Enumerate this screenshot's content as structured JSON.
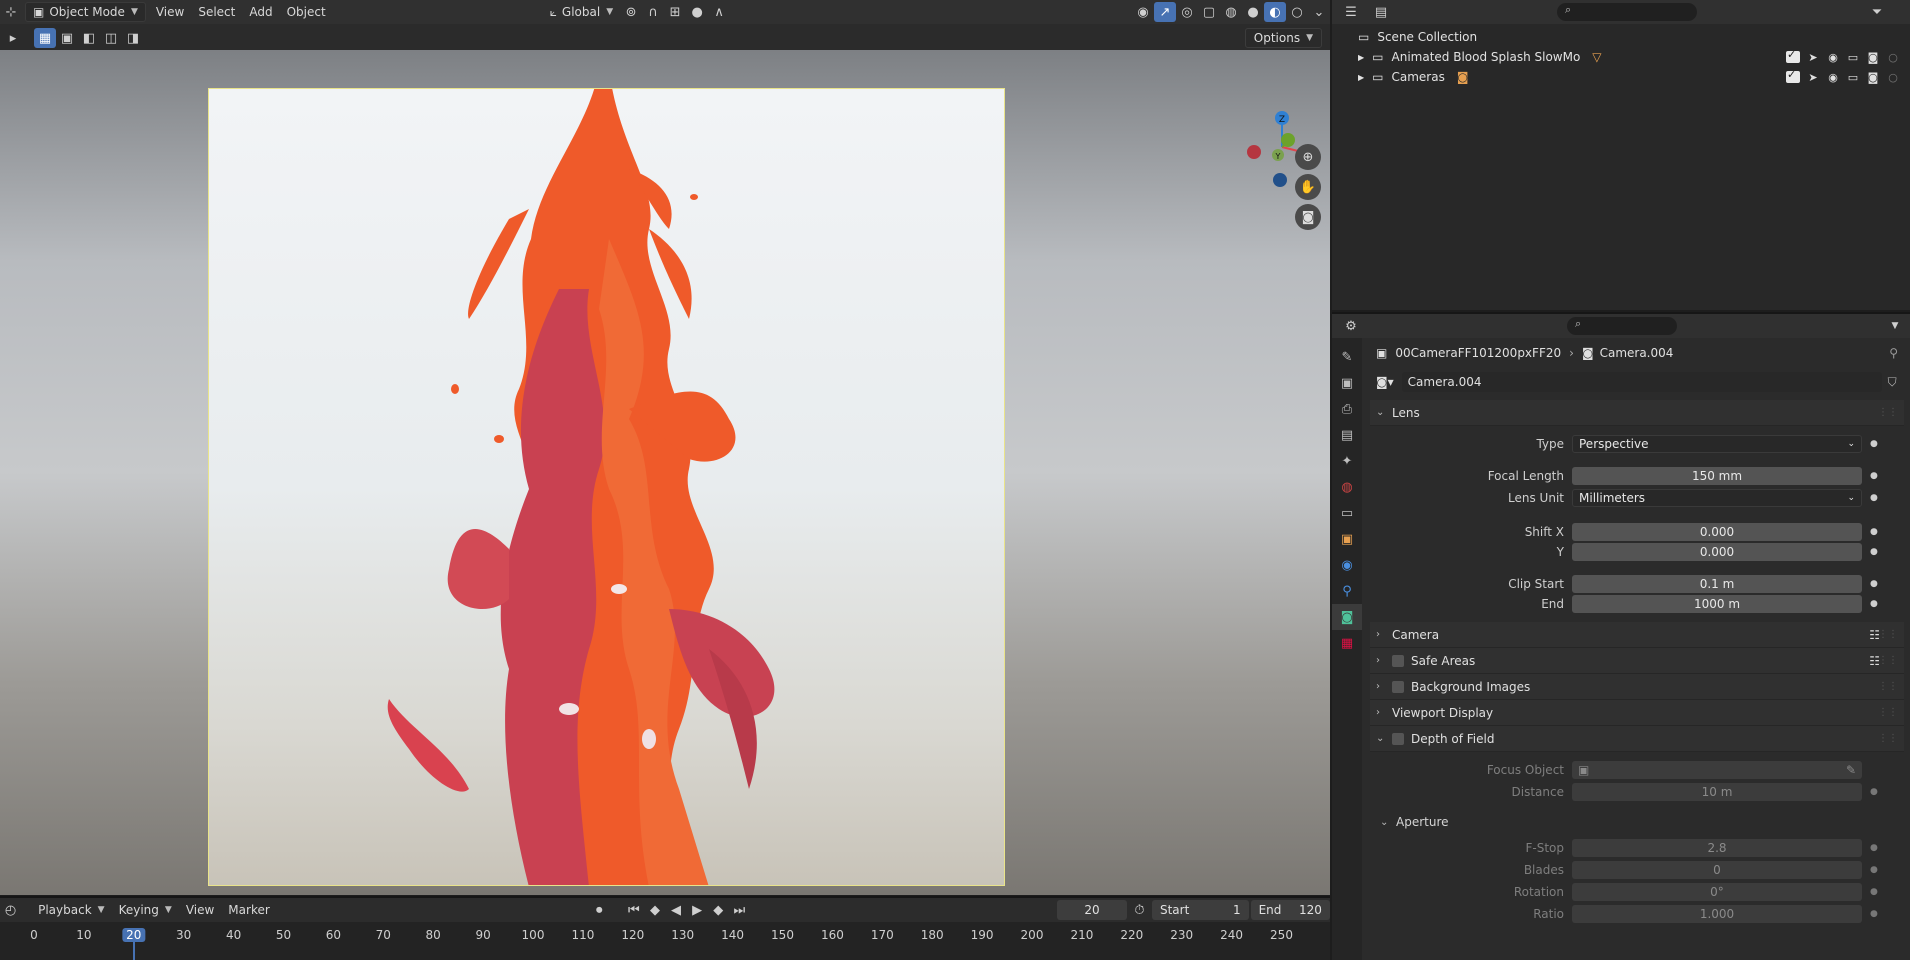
{
  "viewport": {
    "mode_label": "Object Mode",
    "menus": [
      "View",
      "Select",
      "Add",
      "Object"
    ],
    "transform_orientation": "Global",
    "options_label": "Options",
    "gizmo_axes": {
      "z": "Z",
      "y": "Y",
      "x": "X"
    },
    "colors": {
      "axis_x": "#e1444d",
      "axis_y": "#6ca22b",
      "axis_z": "#2f80d3",
      "frame": "#e9e48a",
      "splash_main": "#ef5a2a",
      "splash_dark": "#c23b45"
    }
  },
  "timeline": {
    "menus": [
      "Playback",
      "Keying",
      "View",
      "Marker"
    ],
    "current_frame": "20",
    "start_label": "Start",
    "start_value": "1",
    "end_label": "End",
    "end_value": "120",
    "ticks": [
      "0",
      "10",
      "20",
      "30",
      "40",
      "50",
      "60",
      "70",
      "80",
      "90",
      "100",
      "110",
      "120",
      "130",
      "140",
      "150",
      "160",
      "170",
      "180",
      "190",
      "200",
      "210",
      "220",
      "230",
      "240",
      "250"
    ],
    "active_tick": "20"
  },
  "outliner": {
    "root_label": "Scene Collection",
    "items": [
      {
        "label": "Animated Blood Splash SlowMo"
      },
      {
        "label": "Cameras"
      }
    ]
  },
  "properties": {
    "object_name": "00CameraFF101200pxFF20",
    "data_name": "Camera.004",
    "datablock_value": "Camera.004",
    "lens": {
      "title": "Lens",
      "type_label": "Type",
      "type_value": "Perspective",
      "focal_label": "Focal Length",
      "focal_value": "150 mm",
      "unit_label": "Lens Unit",
      "unit_value": "Millimeters",
      "shiftx_label": "Shift X",
      "shiftx_value": "0.000",
      "shifty_label": "Y",
      "shifty_value": "0.000",
      "clipstart_label": "Clip Start",
      "clipstart_value": "0.1 m",
      "clipend_label": "End",
      "clipend_value": "1000 m"
    },
    "panels": {
      "camera": "Camera",
      "safe_areas": "Safe Areas",
      "background_images": "Background Images",
      "viewport_display": "Viewport Display",
      "dof": "Depth of Field"
    },
    "dof": {
      "focus_object_label": "Focus Object",
      "distance_label": "Distance",
      "distance_value": "10 m",
      "aperture_title": "Aperture",
      "fstop_label": "F-Stop",
      "fstop_value": "2.8",
      "blades_label": "Blades",
      "blades_value": "0",
      "rotation_label": "Rotation",
      "rotation_value": "0°",
      "ratio_label": "Ratio",
      "ratio_value": "1.000"
    }
  }
}
